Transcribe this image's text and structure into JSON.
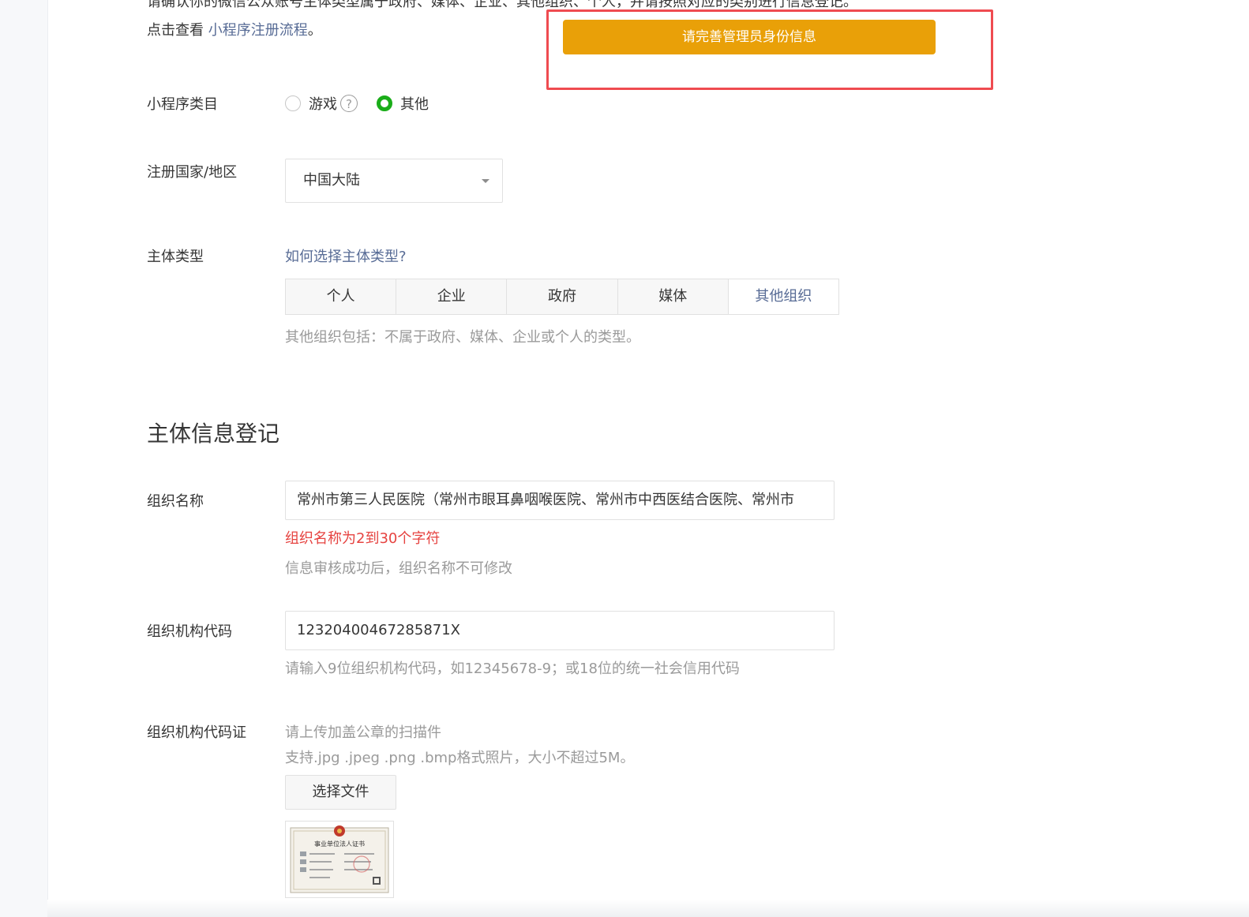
{
  "intro": {
    "line1": "请确认你的微信公众账号主体类型属于政府、媒体、企业、其他组织、个人，并请按照对应的类别进行信息登记。",
    "line2_prefix": "点击查看 ",
    "line2_link": "小程序注册流程",
    "line2_suffix": "。"
  },
  "notice": {
    "button_label": "请完善管理员身份信息",
    "highlight_color": "#ef4b50",
    "button_color": "#e9a008"
  },
  "category": {
    "label": "小程序类目",
    "options": [
      {
        "label": "游戏",
        "checked": false
      },
      {
        "label": "其他",
        "checked": true
      }
    ],
    "help_icon": "question-circle-icon"
  },
  "region": {
    "label": "注册国家/地区",
    "selected": "中国大陆"
  },
  "subject_type": {
    "label": "主体类型",
    "help_link": "如何选择主体类型?",
    "tabs": [
      "个人",
      "企业",
      "政府",
      "媒体",
      "其他组织"
    ],
    "active_tab": "其他组织",
    "hint": "其他组织包括：不属于政府、媒体、企业或个人的类型。"
  },
  "registration": {
    "title": "主体信息登记",
    "org_name": {
      "label": "组织名称",
      "value": "常州市第三人民医院（常州市眼耳鼻咽喉医院、常州市中西医结合医院、常州市",
      "error": "组织名称为2到30个字符",
      "hint": "信息审核成功后，组织名称不可修改"
    },
    "org_code": {
      "label": "组织机构代码",
      "value": "12320400467285871X",
      "hint": "请输入9位组织机构代码，如12345678-9；或18位的统一社会信用代码"
    },
    "org_cert": {
      "label": "组织机构代码证",
      "hint1": "请上传加盖公章的扫描件",
      "hint2": "支持.jpg .jpeg .png .bmp格式照片，大小不超过5M。",
      "button_label": "选择文件",
      "thumbnail_title": "事业单位法人证书"
    }
  },
  "colors": {
    "accent_green": "#1aad19",
    "link_blue": "#576b95",
    "error_red": "#e64340"
  }
}
